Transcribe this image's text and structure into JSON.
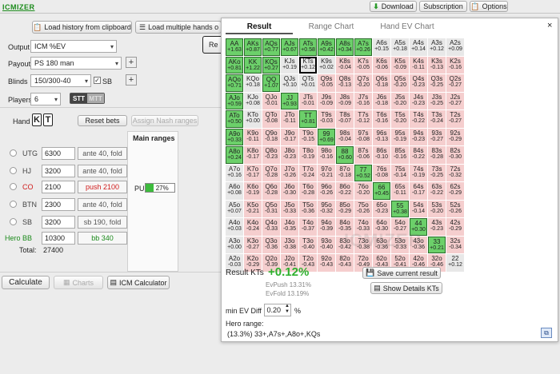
{
  "brand": "ICMIZER",
  "top": {
    "download": "Download",
    "subscription": "Subscription",
    "options": "Options"
  },
  "left": {
    "load_history": "Load history from clipboard",
    "load_multiple": "Load multiple hands o",
    "re": "Re",
    "output_label": "Output",
    "output_value": "ICM %EV",
    "payout_label": "Payout",
    "payout_value": "PS 180 man",
    "blinds_label": "Blinds",
    "blinds_value": "150/300-40",
    "sb_label": "SB",
    "players_label": "Players",
    "players_value": "6",
    "stt": "STT",
    "mtt": "MTT",
    "hand_label": "Hand",
    "card1": "K",
    "card2": "T",
    "reset_bets": "Reset bets",
    "assign_nash": "Assign Nash ranges",
    "main_ranges": "Main ranges",
    "pu_label": "PU",
    "pu_pct": "27%",
    "pu_fill": 0.27,
    "seats": [
      {
        "pos": "UTG",
        "stack": "6300",
        "action": "ante 40, fold",
        "style": "normal"
      },
      {
        "pos": "HJ",
        "stack": "3200",
        "action": "ante 40, fold",
        "style": "normal"
      },
      {
        "pos": "CO",
        "stack": "2100",
        "action": "push 2100",
        "style": "push"
      },
      {
        "pos": "BTN",
        "stack": "2300",
        "action": "ante 40, fold",
        "style": "normal"
      },
      {
        "pos": "SB",
        "stack": "3200",
        "action": "sb 190, fold",
        "style": "normal"
      },
      {
        "pos": "Hero BB",
        "stack": "10300",
        "action": "bb 340",
        "style": "hero"
      }
    ],
    "total_label": "Total:",
    "total_value": "27400",
    "calculate": "Calculate",
    "charts": "Charts",
    "icm_calc": "ICM Calculator"
  },
  "panel": {
    "tabs": [
      "Result",
      "Range Chart",
      "Hand EV Chart"
    ],
    "close": "×",
    "result_label": "Result KTs",
    "result_value": "+0.12%",
    "evpush": "EvPush 13.31%",
    "evfold": "EvFold 13.19%",
    "save": "Save current result",
    "show_details": "Show Details KTs",
    "min_ev_label": "min EV Diff",
    "min_ev_value": "0.20",
    "pct": "%",
    "hero_range_label": "Hero range:",
    "hero_range": "(13.3%) 33+,A7s+,A8o+,KQs",
    "watermark": "ICMIZER"
  },
  "colors": {
    "push": "#6cd06a",
    "fold": "#f5cece",
    "neutral": "#e8e8e8",
    "accent": "#1a8a1a",
    "red": "#d01c1c"
  },
  "grid": [
    [
      [
        "AA",
        "+1.63",
        "p"
      ],
      [
        "AKs",
        "+0.87",
        "p"
      ],
      [
        "AQs",
        "+0.77",
        "p"
      ],
      [
        "AJs",
        "+0.67",
        "p"
      ],
      [
        "ATs",
        "+0.58",
        "p"
      ],
      [
        "A9s",
        "+0.42",
        "p"
      ],
      [
        "A8s",
        "+0.34",
        "p"
      ],
      [
        "A7s",
        "+0.26",
        "p"
      ],
      [
        "A6s",
        "+0.15",
        "n"
      ],
      [
        "A5s",
        "+0.18",
        "n"
      ],
      [
        "A4s",
        "+0.14",
        "n"
      ],
      [
        "A3s",
        "+0.12",
        "n"
      ],
      [
        "A2s",
        "+0.09",
        "n"
      ]
    ],
    [
      [
        "AKo",
        "+0.81",
        "p"
      ],
      [
        "KK",
        "+1.22",
        "p"
      ],
      [
        "KQs",
        "+0.27",
        "p"
      ],
      [
        "KJs",
        "+0.19",
        "n"
      ],
      [
        "KTs",
        "+0.12",
        "s"
      ],
      [
        "K9s",
        "+0.02",
        "n"
      ],
      [
        "K8s",
        "-0.04",
        "b"
      ],
      [
        "K7s",
        "-0.05",
        "b"
      ],
      [
        "K6s",
        "-0.06",
        "b"
      ],
      [
        "K5s",
        "-0.09",
        "b"
      ],
      [
        "K4s",
        "-0.11",
        "b"
      ],
      [
        "K3s",
        "-0.13",
        "b"
      ],
      [
        "K2s",
        "-0.16",
        "b"
      ]
    ],
    [
      [
        "AQo",
        "+0.71",
        "p"
      ],
      [
        "KQo",
        "+0.18",
        "n"
      ],
      [
        "QQ",
        "+1.07",
        "p"
      ],
      [
        "QJs",
        "+0.10",
        "n"
      ],
      [
        "QTs",
        "+0.01",
        "n"
      ],
      [
        "Q9s",
        "-0.05",
        "b"
      ],
      [
        "Q8s",
        "-0.13",
        "b"
      ],
      [
        "Q7s",
        "-0.20",
        "b"
      ],
      [
        "Q6s",
        "-0.18",
        "b"
      ],
      [
        "Q5s",
        "-0.20",
        "b"
      ],
      [
        "Q4s",
        "-0.23",
        "b"
      ],
      [
        "Q3s",
        "-0.25",
        "b"
      ],
      [
        "Q2s",
        "-0.27",
        "b"
      ]
    ],
    [
      [
        "AJo",
        "+0.59",
        "p"
      ],
      [
        "KJo",
        "+0.08",
        "n"
      ],
      [
        "QJo",
        "-0.01",
        "b"
      ],
      [
        "JJ",
        "+0.93",
        "p"
      ],
      [
        "JTs",
        "-0.01",
        "b"
      ],
      [
        "J9s",
        "-0.09",
        "b"
      ],
      [
        "J8s",
        "-0.09",
        "b"
      ],
      [
        "J7s",
        "-0.16",
        "b"
      ],
      [
        "J6s",
        "-0.18",
        "b"
      ],
      [
        "J5s",
        "-0.20",
        "b"
      ],
      [
        "J4s",
        "-0.23",
        "b"
      ],
      [
        "J3s",
        "-0.25",
        "b"
      ],
      [
        "J2s",
        "-0.27",
        "b"
      ]
    ],
    [
      [
        "ATo",
        "+0.50",
        "p"
      ],
      [
        "KTo",
        "+0.00",
        "n"
      ],
      [
        "QTo",
        "-0.08",
        "b"
      ],
      [
        "JTo",
        "-0.11",
        "b"
      ],
      [
        "TT",
        "+0.81",
        "p"
      ],
      [
        "T9s",
        "-0.03",
        "b"
      ],
      [
        "T8s",
        "-0.07",
        "b"
      ],
      [
        "T7s",
        "-0.12",
        "b"
      ],
      [
        "T6s",
        "-0.16",
        "b"
      ],
      [
        "T5s",
        "-0.20",
        "b"
      ],
      [
        "T4s",
        "-0.22",
        "b"
      ],
      [
        "T3s",
        "-0.24",
        "b"
      ],
      [
        "T2s",
        "-0.27",
        "b"
      ]
    ],
    [
      [
        "A9o",
        "+0.33",
        "p"
      ],
      [
        "K9o",
        "-0.11",
        "b"
      ],
      [
        "Q9o",
        "-0.18",
        "b"
      ],
      [
        "J9o",
        "-0.17",
        "b"
      ],
      [
        "T9o",
        "-0.15",
        "b"
      ],
      [
        "99",
        "+0.69",
        "p"
      ],
      [
        "98s",
        "-0.04",
        "b"
      ],
      [
        "97s",
        "-0.08",
        "b"
      ],
      [
        "96s",
        "-0.13",
        "b"
      ],
      [
        "95s",
        "-0.19",
        "b"
      ],
      [
        "94s",
        "-0.23",
        "b"
      ],
      [
        "93s",
        "-0.27",
        "b"
      ],
      [
        "92s",
        "-0.29",
        "b"
      ]
    ],
    [
      [
        "A8o",
        "+0.24",
        "p"
      ],
      [
        "K8o",
        "-0.17",
        "b"
      ],
      [
        "Q8o",
        "-0.23",
        "b"
      ],
      [
        "J8o",
        "-0.23",
        "b"
      ],
      [
        "T8o",
        "-0.19",
        "b"
      ],
      [
        "98o",
        "-0.16",
        "b"
      ],
      [
        "88",
        "+0.60",
        "p"
      ],
      [
        "87s",
        "-0.06",
        "b"
      ],
      [
        "86s",
        "-0.10",
        "b"
      ],
      [
        "85s",
        "-0.16",
        "b"
      ],
      [
        "84s",
        "-0.22",
        "b"
      ],
      [
        "83s",
        "-0.28",
        "b"
      ],
      [
        "82s",
        "-0.30",
        "b"
      ]
    ],
    [
      [
        "A7o",
        "+0.16",
        "n"
      ],
      [
        "K7o",
        "-0.17",
        "b"
      ],
      [
        "Q7o",
        "-0.28",
        "b"
      ],
      [
        "J7o",
        "-0.26",
        "b"
      ],
      [
        "T7o",
        "-0.24",
        "b"
      ],
      [
        "97o",
        "-0.21",
        "b"
      ],
      [
        "87o",
        "-0.18",
        "b"
      ],
      [
        "77",
        "+0.52",
        "p"
      ],
      [
        "76s",
        "-0.08",
        "b"
      ],
      [
        "75s",
        "-0.14",
        "b"
      ],
      [
        "74s",
        "-0.19",
        "b"
      ],
      [
        "73s",
        "-0.25",
        "b"
      ],
      [
        "72s",
        "-0.32",
        "b"
      ]
    ],
    [
      [
        "A6o",
        "+0.08",
        "n"
      ],
      [
        "K6o",
        "-0.19",
        "b"
      ],
      [
        "Q6o",
        "-0.28",
        "b"
      ],
      [
        "J6o",
        "-0.30",
        "b"
      ],
      [
        "T6o",
        "-0.28",
        "b"
      ],
      [
        "96o",
        "-0.26",
        "b"
      ],
      [
        "86o",
        "-0.22",
        "b"
      ],
      [
        "76o",
        "-0.20",
        "b"
      ],
      [
        "66",
        "+0.45",
        "p"
      ],
      [
        "65s",
        "-0.11",
        "b"
      ],
      [
        "64s",
        "-0.17",
        "b"
      ],
      [
        "63s",
        "-0.22",
        "b"
      ],
      [
        "62s",
        "-0.29",
        "b"
      ]
    ],
    [
      [
        "A5o",
        "+0.07",
        "n"
      ],
      [
        "K5o",
        "-0.21",
        "b"
      ],
      [
        "Q5o",
        "-0.31",
        "b"
      ],
      [
        "J5o",
        "-0.33",
        "b"
      ],
      [
        "T5o",
        "-0.36",
        "b"
      ],
      [
        "95o",
        "-0.32",
        "b"
      ],
      [
        "85o",
        "-0.29",
        "b"
      ],
      [
        "75o",
        "-0.26",
        "b"
      ],
      [
        "65o",
        "-0.23",
        "b"
      ],
      [
        "55",
        "+0.38",
        "p"
      ],
      [
        "54s",
        "-0.14",
        "b"
      ],
      [
        "53s",
        "-0.20",
        "b"
      ],
      [
        "52s",
        "-0.26",
        "b"
      ]
    ],
    [
      [
        "A4o",
        "+0.03",
        "n"
      ],
      [
        "K4o",
        "-0.24",
        "b"
      ],
      [
        "Q4o",
        "-0.33",
        "b"
      ],
      [
        "J4o",
        "-0.35",
        "b"
      ],
      [
        "T4o",
        "-0.37",
        "b"
      ],
      [
        "94o",
        "-0.39",
        "b"
      ],
      [
        "84o",
        "-0.35",
        "b"
      ],
      [
        "74o",
        "-0.33",
        "b"
      ],
      [
        "64o",
        "-0.30",
        "b"
      ],
      [
        "54o",
        "-0.27",
        "b"
      ],
      [
        "44",
        "+0.30",
        "p"
      ],
      [
        "43s",
        "-0.23",
        "b"
      ],
      [
        "42s",
        "-0.29",
        "b"
      ]
    ],
    [
      [
        "A3o",
        "+0.00",
        "n"
      ],
      [
        "K3o",
        "-0.27",
        "b"
      ],
      [
        "Q3o",
        "-0.36",
        "b"
      ],
      [
        "J3o",
        "-0.38",
        "b"
      ],
      [
        "T3o",
        "-0.40",
        "b"
      ],
      [
        "93o",
        "-0.40",
        "b"
      ],
      [
        "83o",
        "-0.42",
        "b"
      ],
      [
        "73o",
        "-0.38",
        "b"
      ],
      [
        "63o",
        "-0.36",
        "b"
      ],
      [
        "53o",
        "-0.33",
        "b"
      ],
      [
        "43o",
        "-0.36",
        "b"
      ],
      [
        "33",
        "+0.21",
        "p"
      ],
      [
        "32s",
        "-0.34",
        "b"
      ]
    ],
    [
      [
        "A2o",
        "-0.03",
        "n"
      ],
      [
        "K2o",
        "-0.29",
        "b"
      ],
      [
        "Q2o",
        "-0.39",
        "b"
      ],
      [
        "J2o",
        "-0.41",
        "b"
      ],
      [
        "T2o",
        "-0.43",
        "b"
      ],
      [
        "92o",
        "-0.43",
        "b"
      ],
      [
        "82o",
        "-0.43",
        "b"
      ],
      [
        "72o",
        "-0.49",
        "b"
      ],
      [
        "62o",
        "-0.43",
        "b"
      ],
      [
        "52o",
        "-0.41",
        "b"
      ],
      [
        "42o",
        "-0.46",
        "b"
      ],
      [
        "32o",
        "-0.46",
        "b"
      ],
      [
        "22",
        "+0.12",
        "n"
      ]
    ]
  ]
}
